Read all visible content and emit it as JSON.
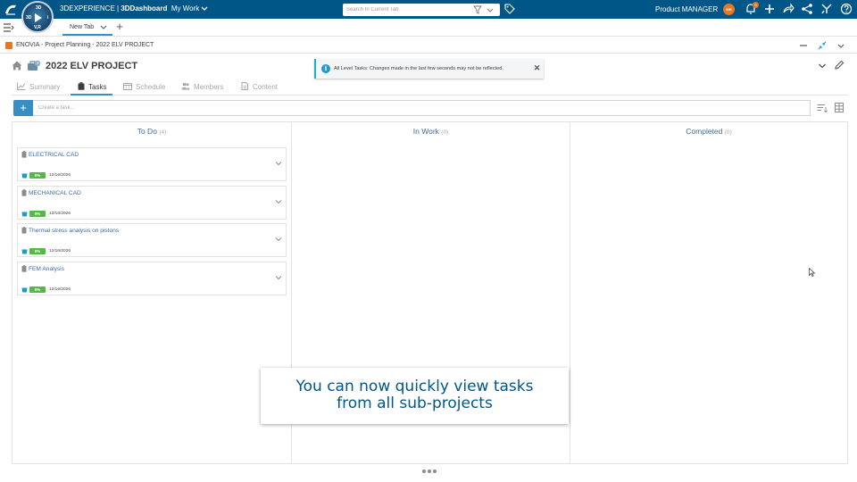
{
  "topbar": {
    "brand_prefix": "3DEXPERIENCE | ",
    "brand_app": "3DDashboard",
    "brand_section": "My Work",
    "search_placeholder": "Search In Current Tab",
    "user_name": "Product MANAGER",
    "user_initials": "MR",
    "notification_count": "9",
    "compass_labels": {
      "top": "3D",
      "left": "3D",
      "right": "i",
      "bottom": "V,R"
    }
  },
  "tabs": {
    "active_label": "New Tab",
    "add_label": "+"
  },
  "widget": {
    "title": "ENOVIA - Project Planning - 2022 ELV PROJECT"
  },
  "project": {
    "title": "2022 ELV PROJECT"
  },
  "toast": {
    "info_glyph": "i",
    "text": "All Level Tasks: Changes made in the last few seconds may not be reflected.",
    "close_glyph": "✕"
  },
  "subtabs": [
    {
      "label": "Summary",
      "icon": "chart-line-icon"
    },
    {
      "label": "Tasks",
      "icon": "clipboard-icon"
    },
    {
      "label": "Schedule",
      "icon": "calendar-icon"
    },
    {
      "label": "Members",
      "icon": "people-icon"
    },
    {
      "label": "Content",
      "icon": "document-icon"
    }
  ],
  "create_task": {
    "button_label": "+",
    "placeholder": "Create a task..."
  },
  "board": {
    "columns": [
      {
        "title": "To Do",
        "count": "(4)",
        "cards": [
          {
            "name": "ELECTRICAL CAD",
            "progress": "0%",
            "date": "12/16/2026"
          },
          {
            "name": "MECHANICAL CAD",
            "progress": "0%",
            "date": "12/16/2026"
          },
          {
            "name": "Thermal stress analysis on pistons",
            "progress": "0%",
            "date": "12/16/2026"
          },
          {
            "name": "FEM Analysis",
            "progress": "0%",
            "date": "12/16/2026"
          }
        ]
      },
      {
        "title": "In Work",
        "count": "(0)",
        "cards": []
      },
      {
        "title": "Completed",
        "count": "(0)",
        "cards": []
      }
    ]
  },
  "caption": {
    "line1": "You can now quickly view tasks",
    "line2": "from all sub-projects"
  },
  "colors": {
    "topbar": "#005686",
    "accent": "#368ec4",
    "progress": "#57b847",
    "brand_orange": "#e87722",
    "toast_accent": "#1bb1d2"
  }
}
